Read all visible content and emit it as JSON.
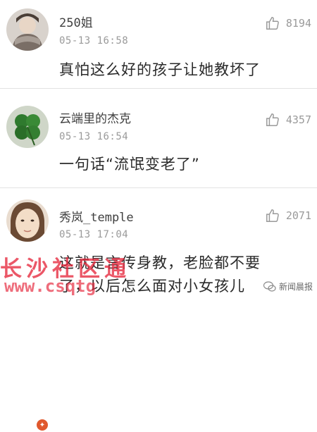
{
  "comments": [
    {
      "username": "250姐",
      "timestamp": "05-13 16:58",
      "likes": "8194",
      "text": "真怕这么好的孩子让她教坏了",
      "avatar_icon": "woman-scarf-avatar",
      "like_icon": "thumbs-up-icon"
    },
    {
      "username": "云端里的杰克",
      "timestamp": "05-13 16:54",
      "likes": "4357",
      "text": "一句话“流氓变老了”",
      "avatar_icon": "clover-avatar",
      "like_icon": "thumbs-up-icon"
    },
    {
      "username": "秀岚_temple",
      "timestamp": "05-13 17:04",
      "likes": "2071",
      "text": "这就是言传身教，老脸都不要",
      "text_line2": "了，以后怎么面对小女孩儿",
      "avatar_icon": "face-avatar",
      "like_icon": "thumbs-up-icon"
    }
  ],
  "watermark": {
    "site_name": "长沙社区通",
    "site_url": "www.csqtg",
    "source": "新闻晨报"
  },
  "colors": {
    "watermark_red": "#e6283c",
    "badge_orange": "#e0582d",
    "muted_gray": "#9a9a9a"
  }
}
